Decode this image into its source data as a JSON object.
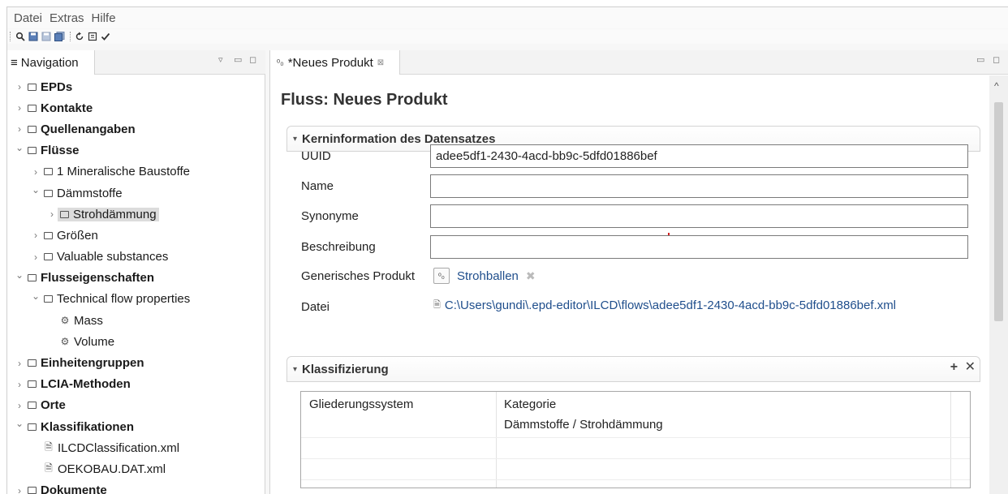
{
  "menubar": {
    "items": [
      "Datei",
      "Extras",
      "Hilfe"
    ]
  },
  "toolbar": {
    "icons": [
      "search-icon",
      "save-icon",
      "save-as-icon",
      "save-all-icon",
      "refresh-icon",
      "validate-icon",
      "check-icon"
    ]
  },
  "navigation": {
    "tab_label": "Navigation",
    "tree": [
      {
        "label": "EPDs",
        "level": 0,
        "expanded": false,
        "bold": true,
        "kind": "folder"
      },
      {
        "label": "Kontakte",
        "level": 0,
        "expanded": false,
        "bold": true,
        "kind": "folder"
      },
      {
        "label": "Quellenangaben",
        "level": 0,
        "expanded": false,
        "bold": true,
        "kind": "folder"
      },
      {
        "label": "Flüsse",
        "level": 0,
        "expanded": true,
        "bold": true,
        "kind": "folder"
      },
      {
        "label": "1 Mineralische Baustoffe",
        "level": 1,
        "expanded": false,
        "bold": false,
        "kind": "folder"
      },
      {
        "label": "Dämmstoffe",
        "level": 1,
        "expanded": true,
        "bold": false,
        "kind": "folder"
      },
      {
        "label": "Strohdämmung",
        "level": 2,
        "expanded": false,
        "bold": false,
        "kind": "folder",
        "selected": true
      },
      {
        "label": "Größen",
        "level": 1,
        "expanded": false,
        "bold": false,
        "kind": "folder"
      },
      {
        "label": "Valuable substances",
        "level": 1,
        "expanded": false,
        "bold": false,
        "kind": "folder"
      },
      {
        "label": "Flusseigenschaften",
        "level": 0,
        "expanded": true,
        "bold": true,
        "kind": "folder"
      },
      {
        "label": "Technical flow properties",
        "level": 1,
        "expanded": true,
        "bold": false,
        "kind": "folder"
      },
      {
        "label": "Mass",
        "level": 2,
        "bold": false,
        "kind": "property"
      },
      {
        "label": "Volume",
        "level": 2,
        "bold": false,
        "kind": "property"
      },
      {
        "label": "Einheitengruppen",
        "level": 0,
        "expanded": false,
        "bold": true,
        "kind": "folder"
      },
      {
        "label": "LCIA-Methoden",
        "level": 0,
        "expanded": false,
        "bold": true,
        "kind": "folder"
      },
      {
        "label": "Orte",
        "level": 0,
        "expanded": false,
        "bold": true,
        "kind": "folder"
      },
      {
        "label": "Klassifikationen",
        "level": 0,
        "expanded": true,
        "bold": true,
        "kind": "folder"
      },
      {
        "label": "ILCDClassification.xml",
        "level": 1,
        "bold": false,
        "kind": "file"
      },
      {
        "label": "OEKOBAU.DAT.xml",
        "level": 1,
        "bold": false,
        "kind": "file"
      },
      {
        "label": "Dokumente",
        "level": 0,
        "expanded": false,
        "bold": true,
        "kind": "folder"
      }
    ]
  },
  "editor": {
    "tab_label": "*Neues Produkt",
    "title": "Fluss: Neues Produkt",
    "core_section": {
      "title": "Kerninformation des Datensatzes",
      "uuid_label": "UUID",
      "uuid_value": "adee5df1-2430-4acd-bb9c-5dfd01886bef",
      "name_label": "Name",
      "name_value": "",
      "synonyms_label": "Synonyme",
      "synonyms_value": "",
      "description_label": "Beschreibung",
      "description_value": "",
      "generic_label": "Generisches Produkt",
      "generic_value": "Strohballen",
      "file_label": "Datei",
      "file_value": "C:\\Users\\gundi\\.epd-editor\\ILCD\\flows\\adee5df1-2430-4acd-bb9c-5dfd01886bef.xml"
    },
    "classification_section": {
      "title": "Klassifizierung",
      "add_label": "+",
      "remove_label": "✕",
      "columns": [
        "Gliederungssystem",
        "Kategorie"
      ],
      "rows": [
        {
          "system": "",
          "category": "Dämmstoffe / Strohdämmung"
        }
      ]
    }
  }
}
